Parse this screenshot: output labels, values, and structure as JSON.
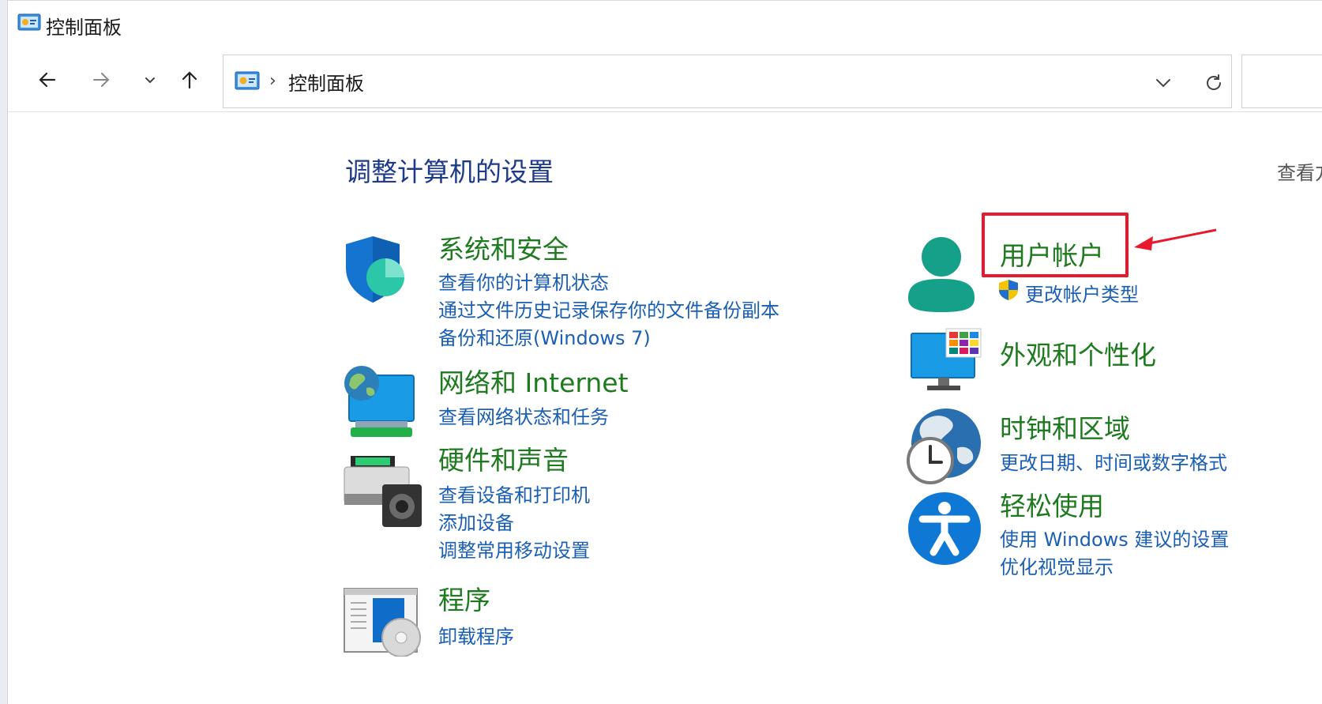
{
  "window": {
    "title": "控制面板"
  },
  "address": {
    "path": "控制面板"
  },
  "page": {
    "title": "调整计算机的设置",
    "view_by": "查看方"
  },
  "categories_left": [
    {
      "title": "系统和安全",
      "links": [
        "查看你的计算机状态",
        "通过文件历史记录保存你的文件备份副本",
        "备份和还原(Windows 7)"
      ]
    },
    {
      "title": "网络和 Internet",
      "links": [
        "查看网络状态和任务"
      ]
    },
    {
      "title": "硬件和声音",
      "links": [
        "查看设备和打印机",
        "添加设备",
        "调整常用移动设置"
      ]
    },
    {
      "title": "程序",
      "links": [
        "卸载程序"
      ]
    }
  ],
  "categories_right": [
    {
      "title": "用户帐户",
      "links": [
        "更改帐户类型"
      ]
    },
    {
      "title": "外观和个性化",
      "links": []
    },
    {
      "title": "时钟和区域",
      "links": [
        "更改日期、时间或数字格式"
      ]
    },
    {
      "title": "轻松使用",
      "links": [
        "使用 Windows 建议的设置",
        "优化视觉显示"
      ]
    }
  ],
  "colors": {
    "title_blue": "#1e3a8a",
    "category_green": "#1e7a1e",
    "link_blue": "#1a5fb4",
    "highlight_red": "#e8192c"
  }
}
